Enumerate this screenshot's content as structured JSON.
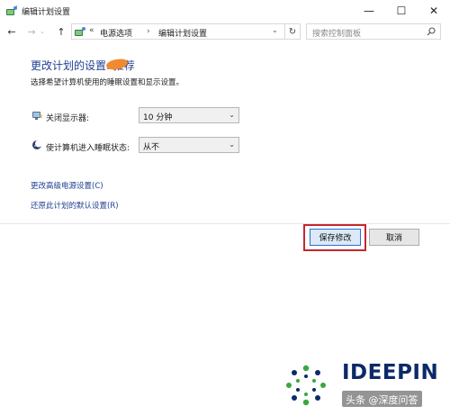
{
  "window": {
    "title": "编辑计划设置",
    "minimize_glyph": "—",
    "maximize_glyph": "☐",
    "close_glyph": "✕"
  },
  "nav": {
    "back_glyph": "←",
    "forward_glyph": "→",
    "recent_glyph": "⌄",
    "up_glyph": "↑"
  },
  "address": {
    "chevron": "«",
    "crumbs": [
      "电源选项",
      "编辑计划设置"
    ],
    "separator": "›",
    "dropdown_glyph": "⌄",
    "refresh_glyph": "↻"
  },
  "search": {
    "placeholder": "搜索控制面板"
  },
  "main": {
    "heading": "更改计划的设置:    推荐",
    "subtitle": "选择希望计算机使用的睡眠设置和显示设置。",
    "settings": [
      {
        "label": "关闭显示器:",
        "value": "10 分钟",
        "icon": "display-icon"
      },
      {
        "label": "使计算机进入睡眠状态:",
        "value": "从不",
        "icon": "sleep-moon-icon"
      }
    ],
    "links": [
      "更改高级电源设置(C)",
      "还原此计划的默认设置(R)"
    ]
  },
  "buttons": {
    "save": "保存修改",
    "cancel": "取消"
  },
  "branding": {
    "logo_text": "IDEEPIN",
    "watermark": "头条 @深度问答"
  },
  "colors": {
    "heading_blue": "#1e3f90",
    "link_blue": "#1e3f90",
    "highlight_red": "#c5272e",
    "save_button_fill": "#dbe9f8",
    "save_button_border": "#2b6fd0",
    "logo_navy": "#0c2a6a",
    "logo_green": "#3aa641"
  }
}
